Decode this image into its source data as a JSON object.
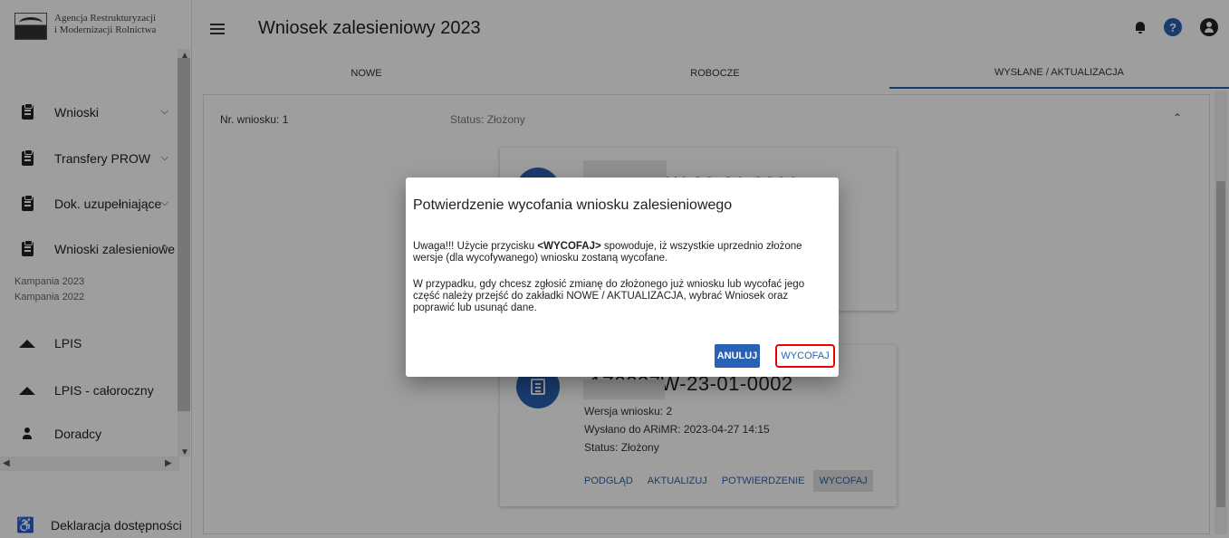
{
  "logo": {
    "line1": "Agencja Restrukturyzacji",
    "line2": "i Modernizacji Rolnictwa"
  },
  "sidebar": {
    "items": [
      {
        "label": "Wnioski"
      },
      {
        "label": "Transfery PROW"
      },
      {
        "label": "Dok. uzupełniające"
      },
      {
        "label": "Wnioski zalesieniowe"
      },
      {
        "label": "LPIS"
      },
      {
        "label": "LPIS - całoroczny"
      },
      {
        "label": "Doradcy"
      }
    ],
    "subitems": [
      "Kampania 2023",
      "Kampania 2022"
    ],
    "declaration": "Deklaracja dostępności"
  },
  "header": {
    "title": "Wniosek zalesieniowy 2023",
    "help": "?"
  },
  "tabs": [
    {
      "label": "NOWE"
    },
    {
      "label": "ROBOCZE"
    },
    {
      "label": "WYSŁANE / AKTUALIZACJA",
      "active": true
    }
  ],
  "panel": {
    "nr": "Nr. wniosku: 1",
    "status": "Status: Złożony"
  },
  "cards": [
    {
      "number": ") T72327W-23-01-0001"
    },
    {
      "number": "-1Z2327W-23-01-0002",
      "version": "Wersja wniosku: 2",
      "sent": "Wysłano do ARiMR: 2023-04-27 14:15",
      "status": "Status: Złożony",
      "actions": [
        "PODGLĄD",
        "AKTUALIZUJ",
        "POTWIERDZENIE",
        "WYCOFAJ"
      ]
    }
  ],
  "dialog": {
    "title": "Potwierdzenie wycofania wniosku zalesieniowego",
    "p1_pre": "Uwaga!!! Użycie przycisku ",
    "p1_bold": "<WYCOFAJ>",
    "p1_post": " spowoduje, iż wszystkie uprzednio złożone wersje (dla wycofywanego) wniosku zostaną wycofane.",
    "p2": "W przypadku, gdy chcesz zgłosić zmianę do złożonego już wniosku lub wycofać jego część należy przejść do zakładki NOWE / AKTUALIZACJA, wybrać Wniosek oraz poprawić lub usunąć dane.",
    "cancel": "ANULUJ",
    "confirm": "WYCOFAJ"
  },
  "colors": {
    "primary": "#2962b4",
    "highlight": "#e00000"
  }
}
